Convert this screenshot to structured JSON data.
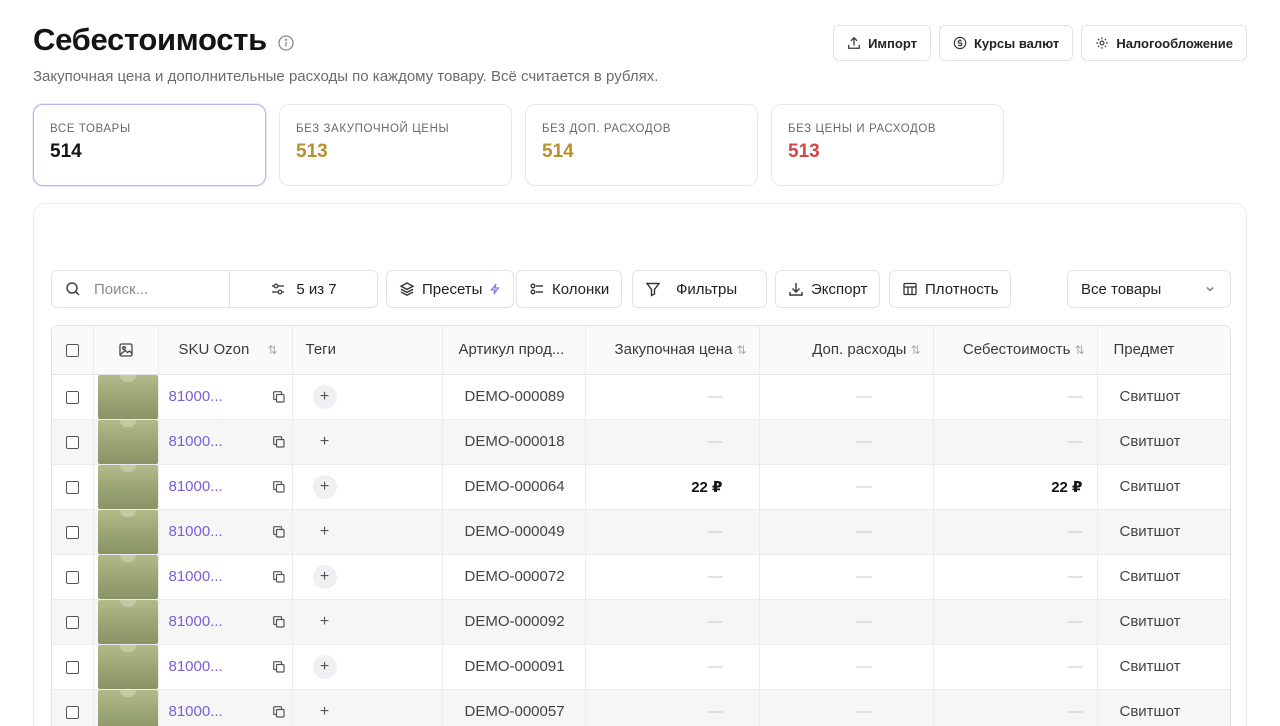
{
  "header": {
    "title": "Себестоимость",
    "subtitle": "Закупочная цена и дополнительные расходы по каждому товару. Всё считается в рублях.",
    "actions": [
      {
        "label": "Импорт",
        "icon": "upload-icon"
      },
      {
        "label": "Курсы валют",
        "icon": "currency-icon"
      },
      {
        "label": "Налогообложение",
        "icon": "gear-icon"
      }
    ]
  },
  "stats": [
    {
      "label": "ВСЕ ТОВАРЫ",
      "value": "514",
      "color": "#141414"
    },
    {
      "label": "БЕЗ ЗАКУПОЧНОЙ ЦЕНЫ",
      "value": "513",
      "color": "#b8912d"
    },
    {
      "label": "БЕЗ ДОП. РАСХОДОВ",
      "value": "514",
      "color": "#b8912d"
    },
    {
      "label": "БЕЗ ЦЕНЫ И РАСХОДОВ",
      "value": "513",
      "color": "#d64545"
    }
  ],
  "toolbar": {
    "search_placeholder": "Поиск...",
    "columns_count": "5 из 7",
    "presets": "Пресеты",
    "columns": "Колонки",
    "filters": "Фильтры",
    "export": "Экспорт",
    "density": "Плотность",
    "filter_select": "Все товары"
  },
  "table": {
    "headers": {
      "sku": "SKU Ozon",
      "tags": "Теги",
      "article": "Артикул прод...",
      "purchase": "Закупочная цена",
      "extra": "Доп. расходы",
      "cost": "Себестоимость",
      "subject": "Предмет"
    },
    "rows": [
      {
        "sku": "81000...",
        "article": "DEMO-000089",
        "purchase": "—",
        "extra": "—",
        "cost": "—",
        "subject": "Свитшот"
      },
      {
        "sku": "81000...",
        "article": "DEMO-000018",
        "purchase": "—",
        "extra": "—",
        "cost": "—",
        "subject": "Свитшот"
      },
      {
        "sku": "81000...",
        "article": "DEMO-000064",
        "purchase": "22 ₽",
        "extra": "—",
        "cost": "22 ₽",
        "subject": "Свитшот"
      },
      {
        "sku": "81000...",
        "article": "DEMO-000049",
        "purchase": "—",
        "extra": "—",
        "cost": "—",
        "subject": "Свитшот"
      },
      {
        "sku": "81000...",
        "article": "DEMO-000072",
        "purchase": "—",
        "extra": "—",
        "cost": "—",
        "subject": "Свитшот"
      },
      {
        "sku": "81000...",
        "article": "DEMO-000092",
        "purchase": "—",
        "extra": "—",
        "cost": "—",
        "subject": "Свитшот"
      },
      {
        "sku": "81000...",
        "article": "DEMO-000091",
        "purchase": "—",
        "extra": "—",
        "cost": "—",
        "subject": "Свитшот"
      },
      {
        "sku": "81000...",
        "article": "DEMO-000057",
        "purchase": "—",
        "extra": "—",
        "cost": "—",
        "subject": "Свитшот"
      }
    ]
  }
}
